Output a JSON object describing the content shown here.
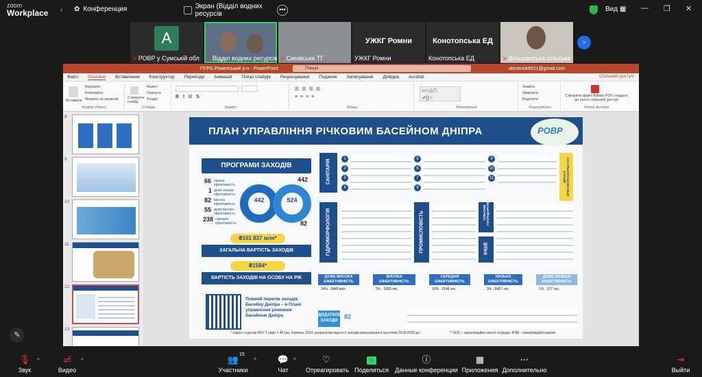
{
  "app": {
    "logo_top": "zoom",
    "logo_bottom": "Workplace",
    "conference_label": "Конференция"
  },
  "screen_share": {
    "label": "Экран (Відділ водних ресурсів"
  },
  "view_label": "Вид",
  "participants_strip": [
    {
      "name": "РОВР у Сумській обл",
      "avatar_letter": "A",
      "muted": true
    },
    {
      "name": "Відділ водних ресурсів Р...",
      "muted": true,
      "active": true
    },
    {
      "name": "Синівська ТГ",
      "muted": true
    },
    {
      "name": "УЖКГ Ромни",
      "big_label": "УЖКГ Ромни",
      "muted": false
    },
    {
      "name": "Конотопська ЕД",
      "big_label": "Конотопська ЕД",
      "muted": false
    },
    {
      "name": "Вільшанська сільська ...",
      "muted": true
    }
  ],
  "powerpoint": {
    "title": "ПУРБ Роменський р-н  ·  PowerPoint",
    "search_placeholder": "Пошук",
    "user": "alenenok8911@gmail.com",
    "share_label": "Спільний доступ",
    "menu": [
      "Файл",
      "Основне",
      "Вставлення",
      "Конструктор",
      "Переходи",
      "Анімація",
      "Показ слайдів",
      "Рецензування",
      "Подання",
      "Записування",
      "Довідка",
      "Acrobat"
    ],
    "ribbon_groups": [
      "Буфер обміну",
      "Слайди",
      "Шрифт",
      "Абзац",
      "Малювання",
      "Редагування",
      "Adobe Acrobat"
    ],
    "ribbon_buttons": {
      "paste": "Вставити",
      "cut": "Вирізати",
      "copy": "Копіювати",
      "format": "Формат за зразком",
      "new_slide": "Створити слайд",
      "layout": "Макет",
      "reset": "Скинути",
      "section": "Розділ",
      "find": "Знайти",
      "replace": "Замінити",
      "select": "Виділити",
      "acrobat": "Створити файл Adobe PDF і надати до нього спільний доступ"
    },
    "thumb_numbers": [
      "8",
      "9",
      "10",
      "11",
      "12",
      "13"
    ],
    "selected_thumb": "12"
  },
  "slide": {
    "title": "ПЛАН УПРАВЛІННЯ РІЧКОВИМ БАСЕЙНОМ ДНІПРА",
    "logo": "РОВР",
    "programs_title": "ПРОГРАМИ ЗАХОДІВ",
    "stats_left": [
      {
        "value": "66",
        "label": "низька ефективність"
      },
      {
        "value": "1",
        "label": "дуже низька ефективність"
      },
      {
        "value": "82",
        "label": "висока ефективність"
      },
      {
        "value": "55",
        "label": "дуже висока ефективність"
      },
      {
        "value": "238",
        "label": "середня ефективність"
      }
    ],
    "donut1_value": "442",
    "donut2_value": "524",
    "stat_right_top": "442",
    "stat_right_bottom": "82",
    "total_cost_value": "₴161 837 млн*",
    "total_cost_label": "ЗАГАЛЬНА ВАРТІСТЬ ЗАХОДІВ",
    "per_person_value": "₴1584*",
    "per_person_label": "ВАРТІСТЬ ЗАХОДІВ НА ОСОБУ НА РІК",
    "qr_text": "Повний перелік заходів басейну Дніпра – в Плані управління річковим басейном Дніпра",
    "sections": [
      "САНІТАРІЯ",
      "ГІДРОМОРФОЛОГІЯ",
      "ПРОМИСЛОВІСТЬ",
      "СІЛЬСЬКЕ ГОСПОДАРСТВО",
      "ІНШЕ",
      "ЗАГАЛЬНОНАЦІОНАЛЬНІ ЗАХОДИ"
    ],
    "efficiency": [
      {
        "label": "ДУЖЕ ВИСОКА ЕФЕКТИВНІСТЬ",
        "pct": "24%",
        "cost": "3449 млн"
      },
      {
        "label": "ВИСОКА ЕФЕКТИВНІСТЬ",
        "pct": "3%",
        "cost": "9383 тис."
      },
      {
        "label": "СЕРЕДНЯ ЕФЕКТИВНІСТЬ",
        "pct": "10%",
        "cost": "3148 тис."
      },
      {
        "label": "НИЗЬКА ЕФЕКТИВНІСТЬ",
        "pct": "3%",
        "cost": "8457 тис."
      },
      {
        "label": "ДУЖЕ НИЗЬКА ЕФЕКТИВНІСТЬ",
        "pct": "1%",
        "cost": "377 тис."
      }
    ],
    "additional": {
      "label": "ДОДАТКОВІ ЗАХОДИ",
      "count": "82"
    },
    "footnote_left": "* згідно з курсом НБУ 1 євро = 45 грн, червень 2024; розрахунки вартості заходів виконувалися протягом 2018-2023 рр.",
    "footnote_right": "** КОС – каналізаційні очисні споруди, КНМ – каналізаційні мережі"
  },
  "toolbar": {
    "audio": "Звук",
    "video": "Видео",
    "participants": "Участники",
    "participants_count": "15",
    "chat": "Чат",
    "react": "Отреагировать",
    "share": "Поделиться",
    "data": "Данные конференции",
    "apps": "Приложения",
    "more": "Дополнительно",
    "leave": "Выйти"
  }
}
